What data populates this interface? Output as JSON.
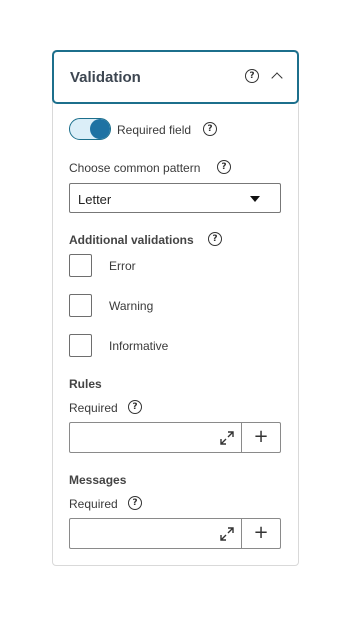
{
  "panel": {
    "title": "Validation",
    "help_glyph": "?",
    "required_field": {
      "label": "Required field",
      "enabled": true
    },
    "pattern": {
      "label": "Choose common pattern",
      "value": "Letter"
    },
    "additional": {
      "label": "Additional validations",
      "options": [
        {
          "label": "Error",
          "checked": false
        },
        {
          "label": "Warning",
          "checked": false
        },
        {
          "label": "Informative",
          "checked": false
        }
      ]
    },
    "rules": {
      "title": "Rules",
      "required_label": "Required",
      "add_label": "+"
    },
    "messages": {
      "title": "Messages",
      "required_label": "Required",
      "add_label": "+"
    }
  },
  "colors": {
    "accent": "#1c6f8c",
    "toggle_on": "#1e72a3"
  },
  "icons": [
    "help-icon",
    "chevron-up-icon",
    "caret-down-icon",
    "expand-icon"
  ]
}
